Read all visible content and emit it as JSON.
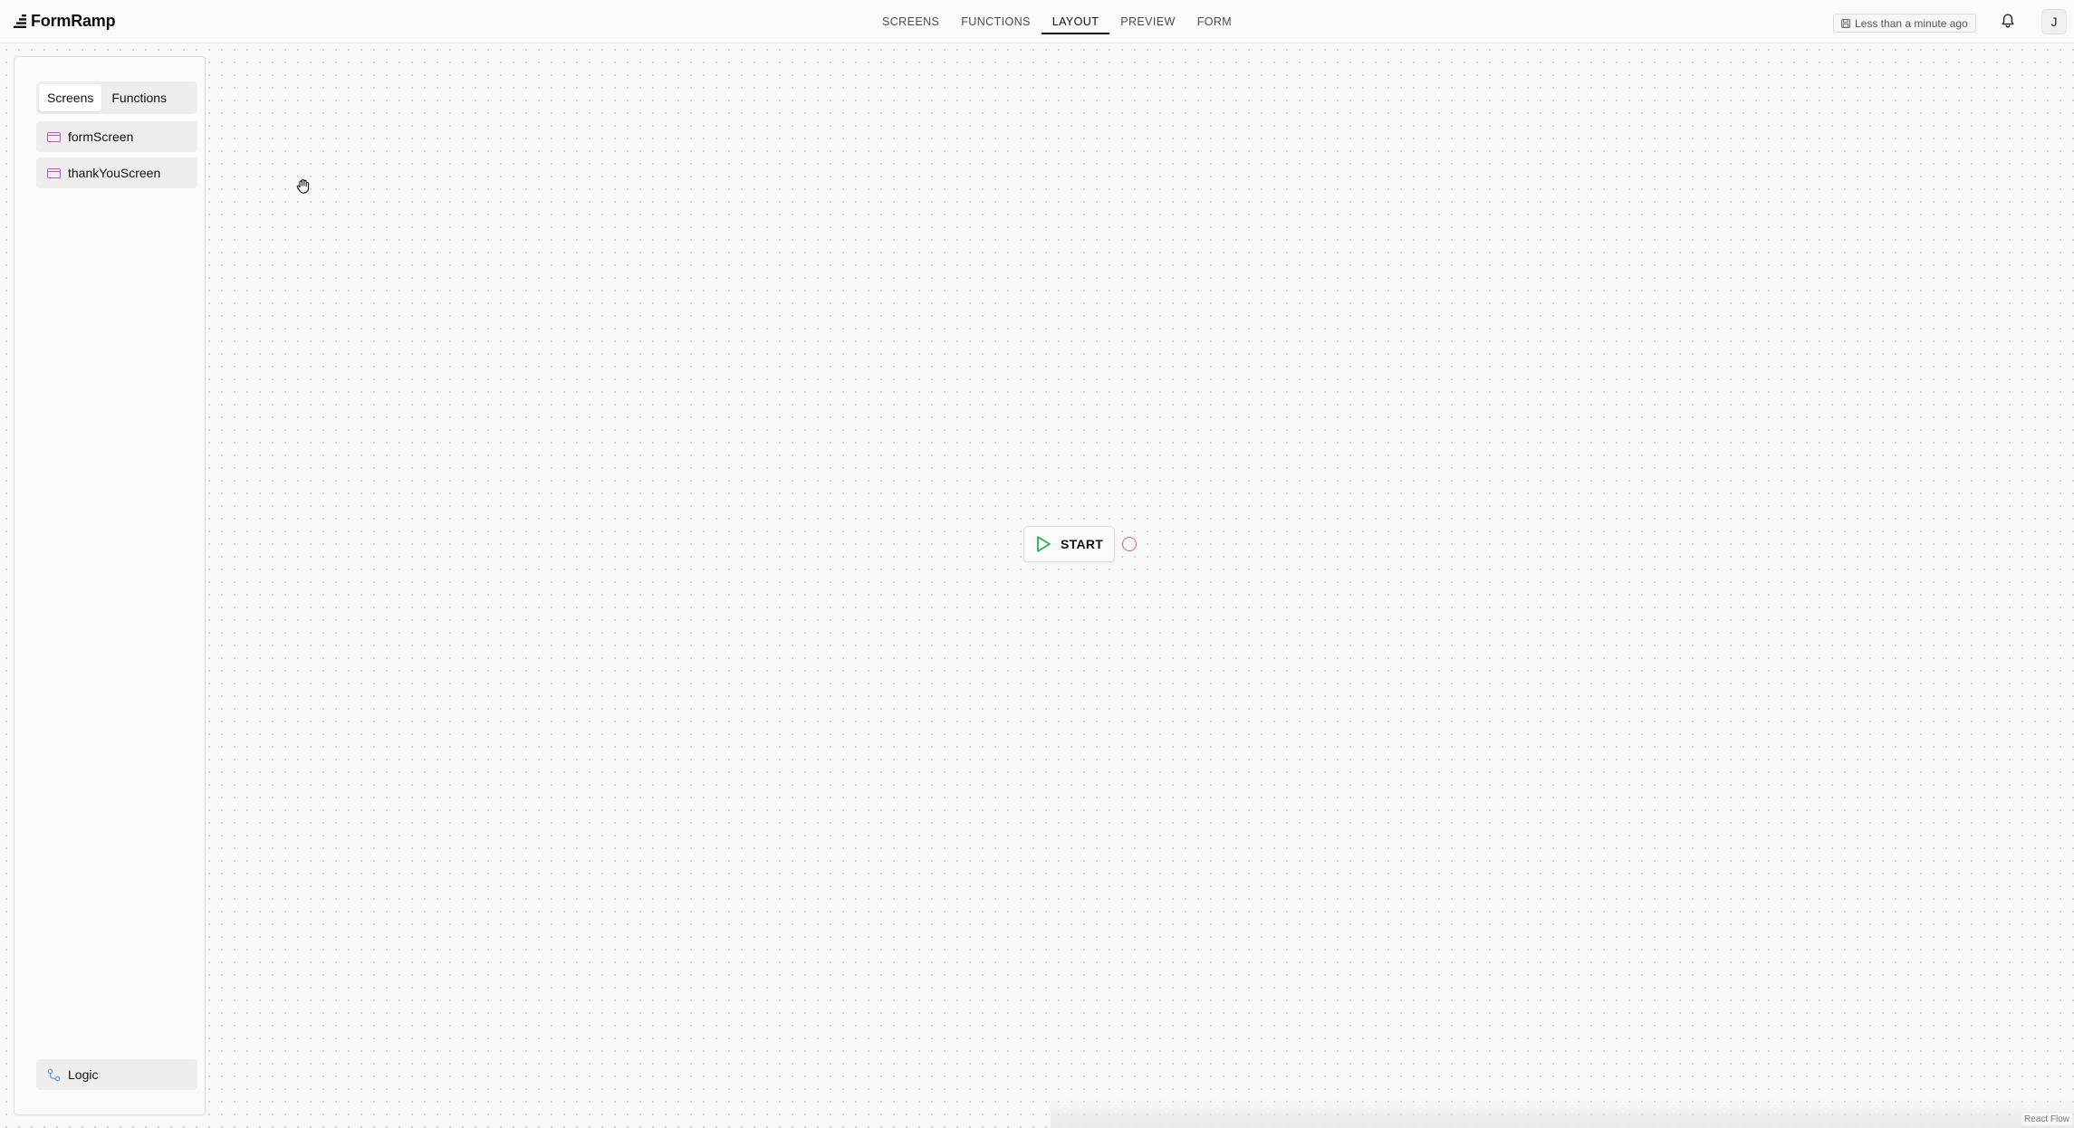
{
  "header": {
    "brand": "FormRamp",
    "nav": [
      {
        "label": "SCREENS"
      },
      {
        "label": "FUNCTIONS"
      },
      {
        "label": "LAYOUT",
        "active": true
      },
      {
        "label": "PREVIEW"
      },
      {
        "label": "FORM"
      }
    ],
    "saved_status": "Less than a minute ago",
    "avatar_initial": "J",
    "icons": {
      "save": "save-icon",
      "notifications": "bell-icon"
    }
  },
  "sidebar": {
    "tabs": [
      {
        "label": "Screens",
        "active": true
      },
      {
        "label": "Functions"
      }
    ],
    "screens": [
      {
        "label": "formScreen",
        "icon": "screen-icon"
      },
      {
        "label": "thankYouScreen",
        "icon": "screen-icon"
      }
    ],
    "logic": {
      "label": "Logic",
      "icon": "logic-icon"
    }
  },
  "canvas": {
    "start_node": {
      "label": "START",
      "icon": "play-icon"
    },
    "attribution": "React Flow"
  },
  "colors": {
    "screen_icon": "#c44fc6",
    "play_icon": "#22b45a",
    "handle": "#e0606a",
    "logic_icon": "#6aa5d8"
  }
}
